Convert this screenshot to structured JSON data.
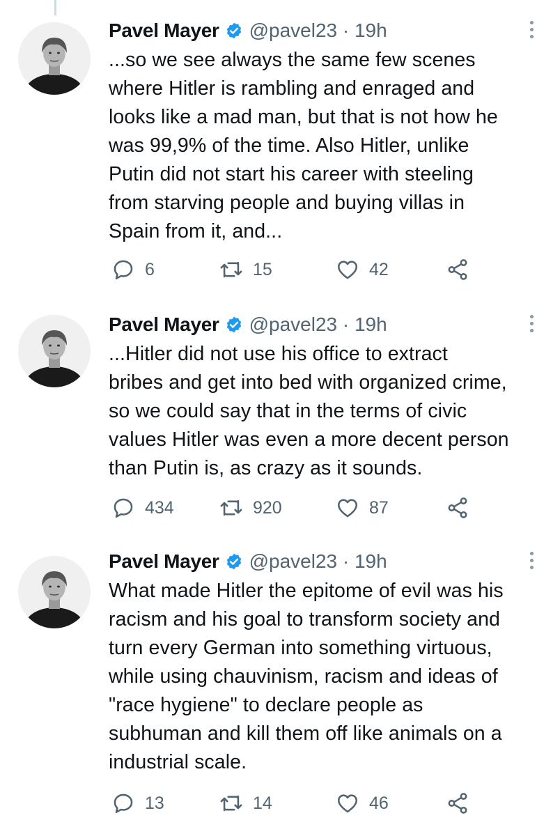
{
  "tweets": [
    {
      "name": "Pavel Mayer",
      "handle": "@pavel23 · 19h",
      "lines": [
        "...so we see always the same few scenes",
        "where Hitler is rambling and enraged and",
        "looks like a mad man, but that is not how he",
        "was 99,9% of the time. Also Hitler, unlike",
        "Putin did not start his career with steeling",
        "from starving people and buying villas in",
        "Spain from it, and..."
      ],
      "replies": "6",
      "retweets": "15",
      "likes": "42"
    },
    {
      "name": "Pavel Mayer",
      "handle": "@pavel23 · 19h",
      "lines": [
        "...Hitler did not use his office to extract",
        "bribes and get into bed with organized crime,",
        "so we could say that in the terms of civic",
        "values Hitler was even a more decent person",
        "than Putin is, as crazy as it sounds."
      ],
      "replies": "434",
      "retweets": "920",
      "likes": "87"
    },
    {
      "name": "Pavel Mayer",
      "handle": "@pavel23 · 19h",
      "lines": [
        "What made Hitler the epitome of evil was his",
        "racism and his goal to transform society and",
        "turn every German into something virtuous,",
        "while using chauvinism, racism and ideas of",
        "\"race hygiene\" to declare people as",
        "subhuman and kill them off like animals on a",
        "industrial scale."
      ],
      "replies": "13",
      "retweets": "14",
      "likes": "46"
    }
  ],
  "icons": {
    "reply": "reply-icon",
    "retweet": "retweet-icon",
    "like": "heart-icon",
    "share": "share-icon",
    "verified": "verified-badge-icon",
    "more": "more-options-icon"
  },
  "colors": {
    "verified": "#1d9bf0",
    "secondary_text": "#536471",
    "thread_line": "#cfd9de"
  }
}
